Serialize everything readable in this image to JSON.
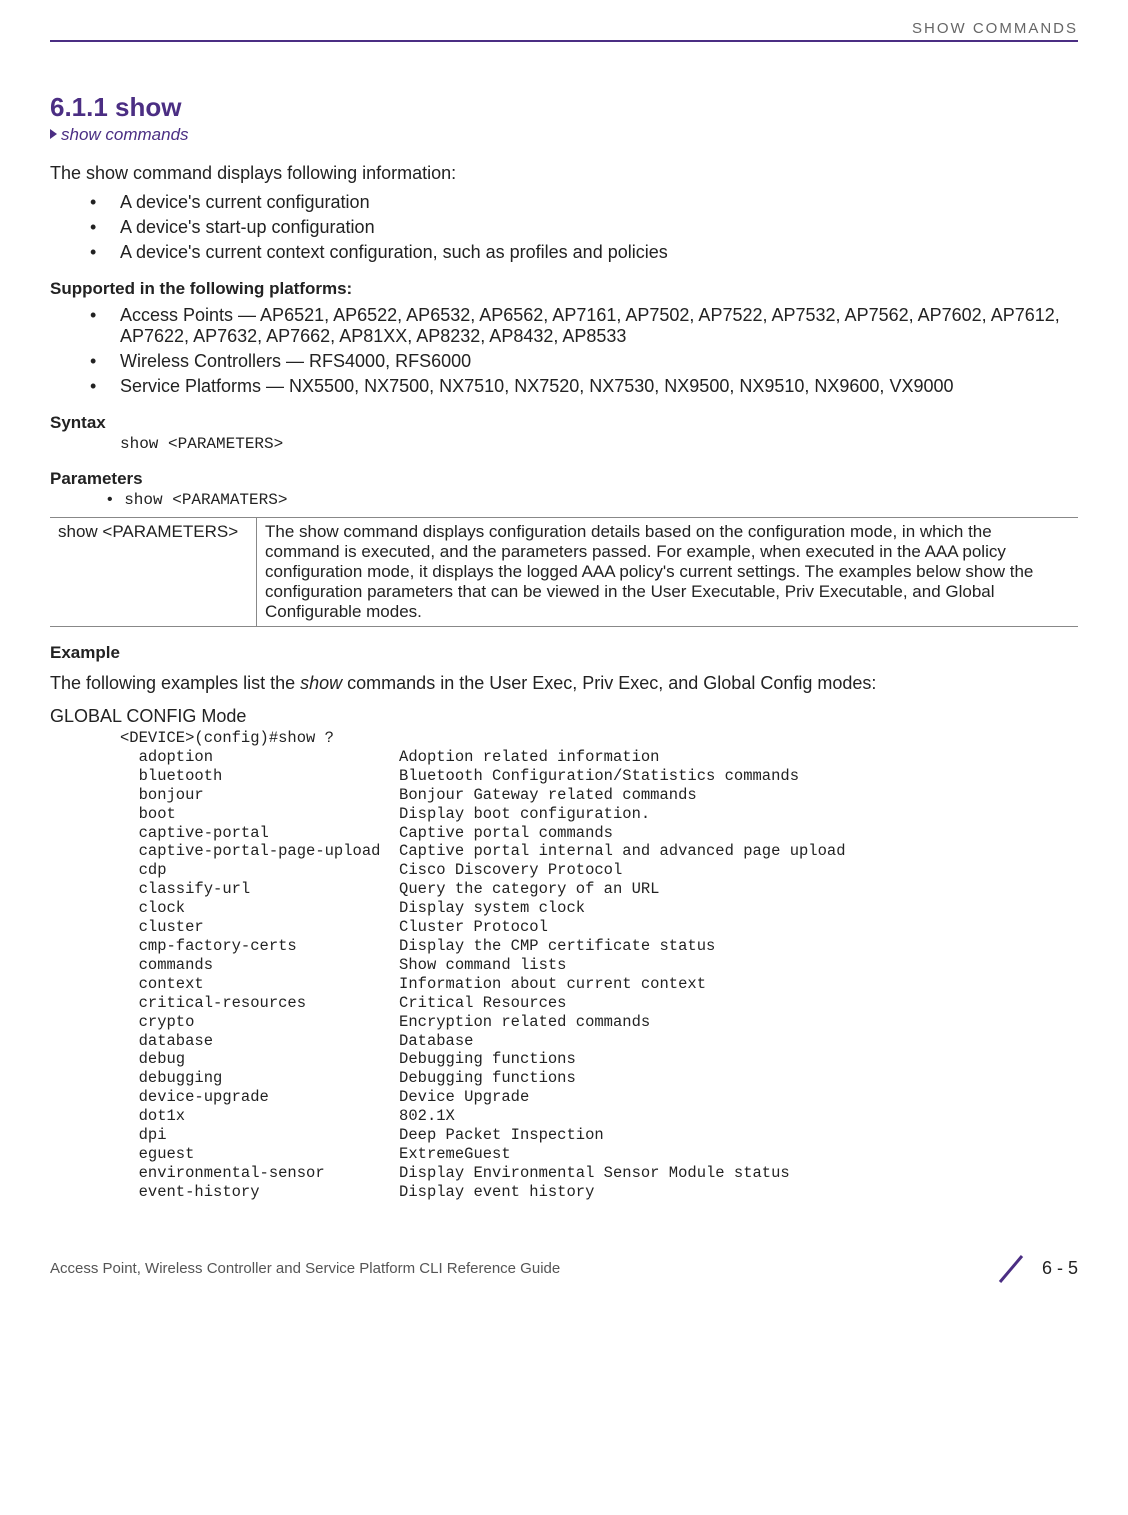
{
  "runningHead": "SHOW COMMANDS",
  "sectionNumber": "6.1.1 show",
  "breadcrumb": "show commands",
  "intro": "The show command displays following information:",
  "bullets1": [
    "A device's current configuration",
    "A device's start-up configuration",
    "A device's current context configuration, such as profiles and policies"
  ],
  "supportedHead": "Supported in the following platforms:",
  "supported": [
    "Access Points — AP6521, AP6522, AP6532, AP6562, AP7161, AP7502, AP7522, AP7532, AP7562, AP7602, AP7612, AP7622, AP7632, AP7662, AP81XX, AP8232, AP8432, AP8533",
    "Wireless Controllers — RFS4000, RFS6000",
    "Service Platforms — NX5500, NX7500, NX7510, NX7520, NX7530, NX9500, NX9510, NX9600, VX9000"
  ],
  "syntaxHead": "Syntax",
  "syntaxCode": "show <PARAMETERS>",
  "parametersHead": "Parameters",
  "paramLine": "• show <PARAMATERS>",
  "paramTable": {
    "left": "show <PARAMETERS>",
    "right": "The show command displays configuration details based on the configuration mode, in which the command is executed, and the parameters passed. For example, when executed in the AAA policy configuration mode, it displays the logged AAA policy's current settings. The examples below show the configuration parameters that can be viewed in the User Executable, Priv Executable, and Global Configurable modes."
  },
  "exampleHead": "Example",
  "exampleIntroPre": "The following examples list the ",
  "exampleIntroItal": "show",
  "exampleIntroPost": " commands in the User Exec, Priv Exec, and Global Config modes:",
  "modeHead": "GLOBAL CONFIG Mode",
  "cli": "<DEVICE>(config)#show ?\n  adoption                    Adoption related information\n  bluetooth                   Bluetooth Configuration/Statistics commands\n  bonjour                     Bonjour Gateway related commands\n  boot                        Display boot configuration.\n  captive-portal              Captive portal commands\n  captive-portal-page-upload  Captive portal internal and advanced page upload\n  cdp                         Cisco Discovery Protocol\n  classify-url                Query the category of an URL\n  clock                       Display system clock\n  cluster                     Cluster Protocol\n  cmp-factory-certs           Display the CMP certificate status\n  commands                    Show command lists\n  context                     Information about current context\n  critical-resources          Critical Resources\n  crypto                      Encryption related commands\n  database                    Database\n  debug                       Debugging functions\n  debugging                   Debugging functions\n  device-upgrade              Device Upgrade\n  dot1x                       802.1X\n  dpi                         Deep Packet Inspection\n  eguest                      ExtremeGuest\n  environmental-sensor        Display Environmental Sensor Module status\n  event-history               Display event history",
  "footerLeft": "Access Point, Wireless Controller and Service Platform CLI Reference Guide",
  "footerPage": "6 - 5"
}
